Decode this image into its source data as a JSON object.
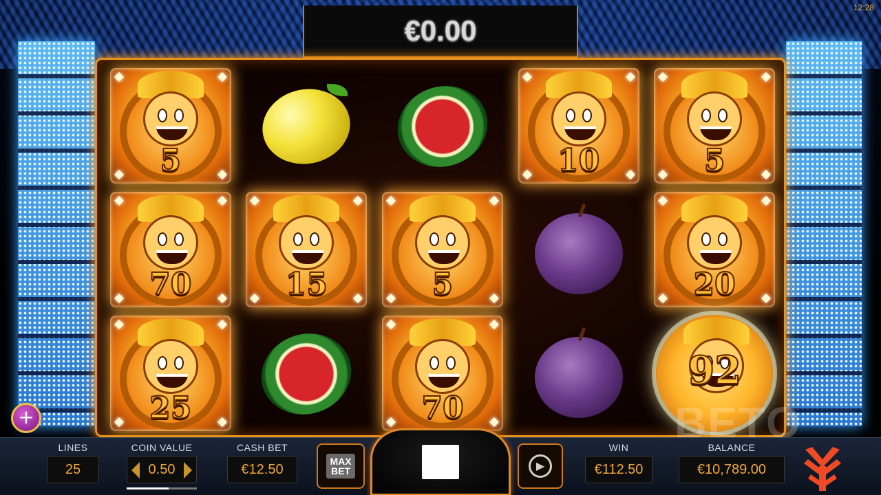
{
  "top_win_display": "€0.00",
  "clock": "12:28",
  "reels": [
    [
      {
        "type": "joker",
        "multiplier": "5"
      },
      {
        "type": "joker",
        "multiplier": "70"
      },
      {
        "type": "joker",
        "multiplier": "25"
      }
    ],
    [
      {
        "type": "lemon"
      },
      {
        "type": "joker",
        "multiplier": "15"
      },
      {
        "type": "watermelon"
      }
    ],
    [
      {
        "type": "watermelon"
      },
      {
        "type": "joker",
        "multiplier": "5"
      },
      {
        "type": "joker",
        "multiplier": "70"
      }
    ],
    [
      {
        "type": "joker",
        "multiplier": "10"
      },
      {
        "type": "plum"
      },
      {
        "type": "plum"
      }
    ],
    [
      {
        "type": "joker",
        "multiplier": "5"
      },
      {
        "type": "joker",
        "multiplier": "20"
      },
      {
        "type": "joker-big",
        "multiplier": "92"
      }
    ]
  ],
  "controls": {
    "lines_label": "LINES",
    "lines_value": "25",
    "coin_value_label": "COIN VALUE",
    "coin_value": "0.50",
    "cash_bet_label": "CASH BET",
    "cash_bet": "€12.50",
    "max_bet_label": "MAX\nBET",
    "win_label": "WIN",
    "win_value": "€112.50",
    "balance_label": "BALANCE",
    "balance_value": "€10,789.00"
  },
  "watermark": "BETO",
  "icons": {
    "plus": "plus-icon",
    "stop": "stop-icon",
    "autoplay": "autoplay-icon",
    "logo": "yggdrasil-logo-icon"
  },
  "colors": {
    "accent_orange": "#e8941a",
    "value_text": "#f1a83a",
    "led_blue": "#5bb8f2",
    "bar_bg": "#1b2538"
  }
}
